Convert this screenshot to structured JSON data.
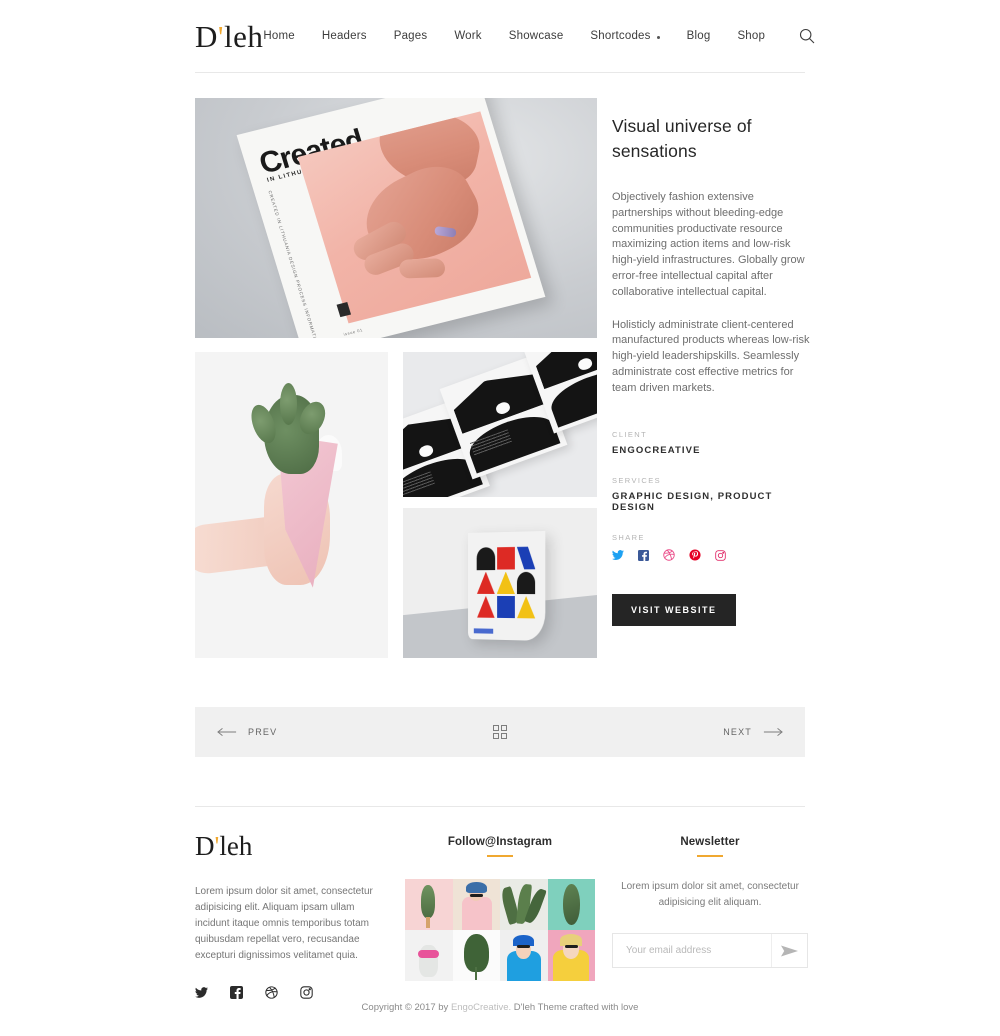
{
  "header": {
    "logo": "D'leh",
    "logo_main": "D",
    "logo_apostrophe": "'",
    "logo_rest": "leh",
    "nav": [
      {
        "label": "Home",
        "has_dropdown": false
      },
      {
        "label": "Headers",
        "has_dropdown": false
      },
      {
        "label": "Pages",
        "has_dropdown": false
      },
      {
        "label": "Work",
        "has_dropdown": false
      },
      {
        "label": "Showcase",
        "has_dropdown": false
      },
      {
        "label": "Shortcodes",
        "has_dropdown": true
      },
      {
        "label": "Blog",
        "has_dropdown": false
      },
      {
        "label": "Shop",
        "has_dropdown": false
      }
    ],
    "search_icon": "search-icon"
  },
  "gallery": {
    "hero": {
      "alt": "magazine-cover-created-in-lithuania",
      "cover_title": "Created",
      "cover_subtitle": "IN LITHUANIA",
      "spine_text": "CREATED IN LITHUANIA DESIGN PROCESS INFORMATION",
      "footnote": "issue 01"
    },
    "thumbs": [
      {
        "alt": "hand-holding-cactus-in-pink-wrapper"
      },
      {
        "alt": "black-and-white-poster-series"
      },
      {
        "alt": "germany-bauhaus-typographic-poster"
      }
    ]
  },
  "project": {
    "title": "Visual universe of sensations",
    "paragraphs": [
      "Objectively fashion extensive partnerships without bleeding-edge communities productivate resource maximizing action items and low-risk high-yield infrastructures. Globally grow error-free intellectual capital after collaborative intellectual capital.",
      "Holisticly administrate client-centered manufactured products whereas low-risk high-yield leadershipskills. Seamlessly administrate cost effective metrics for team driven markets."
    ],
    "client_label": "CLIENT",
    "client_value": "ENGOCREATIVE",
    "services_label": "SERVICES",
    "services_value": "GRAPHIC DESIGN, PRODUCT DESIGN",
    "share_label": "SHARE",
    "share_links": [
      {
        "name": "twitter-icon",
        "color": "#1da1f2"
      },
      {
        "name": "facebook-icon",
        "color": "#3b5998"
      },
      {
        "name": "dribbble-icon",
        "color": "#ea4c89"
      },
      {
        "name": "pinterest-icon",
        "color": "#e60023"
      },
      {
        "name": "instagram-icon",
        "color": "#e1306c"
      }
    ],
    "visit_button": "VISIT WEBSITE"
  },
  "pagination": {
    "prev_label": "PREV",
    "next_label": "NEXT",
    "grid_icon": "grid-icon",
    "back_arrow": "arrow-left-icon",
    "forward_arrow": "arrow-right-icon"
  },
  "footer": {
    "logo": "D'leh",
    "logo_main": "D",
    "logo_apostrophe": "'",
    "logo_rest": "leh",
    "about_text": "Lorem ipsum dolor sit amet, consectetur adipisicing elit. Aliquam ipsam ullam incidunt itaque omnis temporibus totam quibusdam repellat vero, recusandae excepturi dignissimos velitamet quia.",
    "social": [
      {
        "name": "twitter-icon"
      },
      {
        "name": "facebook-icon"
      },
      {
        "name": "dribbble-icon"
      },
      {
        "name": "instagram-icon"
      }
    ],
    "instagram": {
      "heading": "Follow@Instagram",
      "accent_color": "#f0a830",
      "tiles": [
        {
          "alt": "cactus-popsicle-on-pink"
        },
        {
          "alt": "woman-in-pink-tshirt-sunglasses"
        },
        {
          "alt": "green-leaves-on-white"
        },
        {
          "alt": "cactus-on-mint-green"
        },
        {
          "alt": "pineapple-with-pink-sunglasses"
        },
        {
          "alt": "monstera-leaf-on-white"
        },
        {
          "alt": "person-in-blue-hoodie-sunglasses"
        },
        {
          "alt": "woman-in-yellow-raincoat-sunglasses"
        }
      ]
    },
    "newsletter": {
      "heading": "Newsletter",
      "accent_color": "#f0a830",
      "text": "Lorem ipsum dolor sit amet, consectetur adipisicing elit aliquam.",
      "placeholder": "Your email address",
      "value": "",
      "submit_icon": "send-icon"
    },
    "copyright_prefix": "Copyright © 2017 by ",
    "copyright_brand": "EngoCreative.",
    "copyright_suffix": " D'leh Theme crafted with love"
  }
}
